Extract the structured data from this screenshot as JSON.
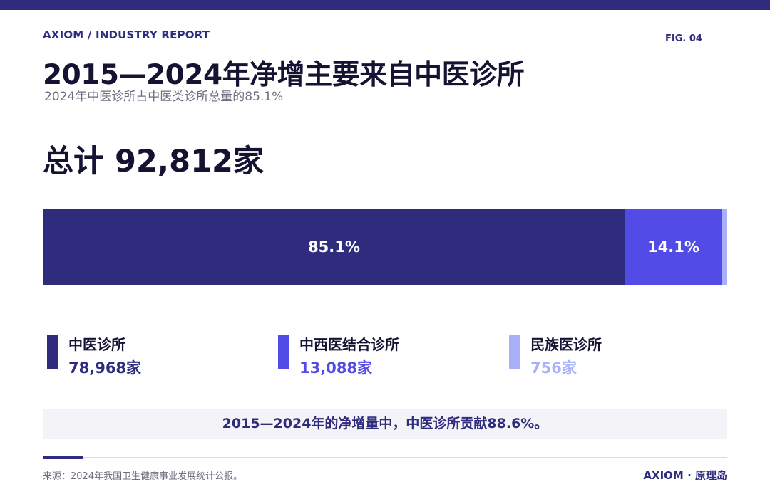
{
  "header": {
    "brand": "AXIOM / INDUSTRY REPORT",
    "fig_label": "FIG. 04",
    "title": "2015—2024年净增主要来自中医诊所",
    "subtitle": "2024年中医诊所占中医类诊所总量的85.1%"
  },
  "total_label": "总计 92,812家",
  "chart_data": {
    "type": "bar",
    "orientation": "horizontal-stacked-100",
    "title": "2015—2024年净增主要来自中医诊所",
    "subtitle": "2024年中医诊所占中医类诊所总量的85.1%",
    "total": 92812,
    "unit": "家",
    "categories": [
      "中医诊所",
      "中西医结合诊所",
      "民族医诊所"
    ],
    "values": [
      78968,
      13088,
      756
    ],
    "shares": [
      85.1,
      14.1,
      0.8
    ],
    "segment_labels": [
      "85.1%",
      "14.1%",
      ""
    ],
    "colors": [
      "#2f2c7e",
      "#534be6",
      "#a7b0f8"
    ]
  },
  "legend": [
    {
      "name": "中医诊所",
      "value": "78,968家",
      "color": "#2f2c7e"
    },
    {
      "name": "中西医结合诊所",
      "value": "13,088家",
      "color": "#534be6"
    },
    {
      "name": "民族医诊所",
      "value": "756家",
      "color": "#a7b0f8"
    }
  ],
  "callout": "2015—2024年的净增量中，中医诊所贡献88.6%。",
  "footer": {
    "source": "来源：2024年我国卫生健康事业发展统计公报。",
    "brand": "AXIOM · 原理岛"
  }
}
